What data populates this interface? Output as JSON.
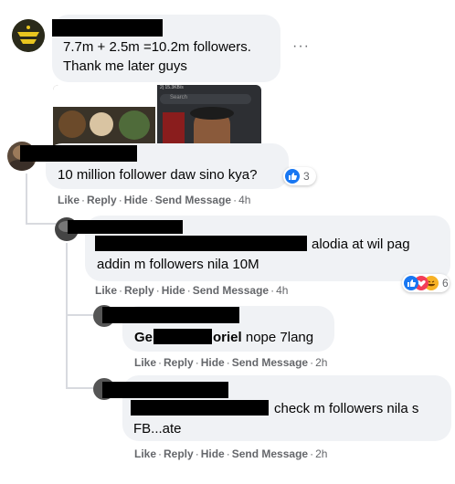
{
  "comments": [
    {
      "text_line1": "7.7m + 2.5m =10.2m followers.",
      "text_line2": "Thank me later guys",
      "more": "···",
      "attachment_left_caption": "",
      "attachment_right_status": "2| 15.3KB/s",
      "attachment_right_search": "Search"
    },
    {
      "text": "10 million follower daw sino kya?",
      "reaction_count": "3",
      "actions": {
        "like": "Like",
        "reply": "Reply",
        "hide": "Hide",
        "send": "Send Message",
        "time": "4h"
      }
    },
    {
      "text_line1": "alodia at wil pag",
      "text_line2": "addin m followers nila 10M",
      "reaction_count": "6",
      "actions": {
        "like": "Like",
        "reply": "Reply",
        "hide": "Hide",
        "send": "Send Message",
        "time": "4h"
      }
    },
    {
      "name_start": "Ge",
      "name_end": "oriel",
      "text": "nope 7lang",
      "actions": {
        "like": "Like",
        "reply": "Reply",
        "hide": "Hide",
        "send": "Send Message",
        "time": "2h"
      }
    },
    {
      "text_line1": "check m followers nila s",
      "text_line2": "FB...ate",
      "actions": {
        "like": "Like",
        "reply": "Reply",
        "hide": "Hide",
        "send": "Send Message",
        "time": "2h"
      }
    }
  ],
  "separator": "·",
  "colors": {
    "bubble": "#f0f2f5",
    "meta": "#65676b",
    "like_blue": "#1877f2",
    "haha_yellow": "#f7b125",
    "love_red": "#f33e58"
  }
}
